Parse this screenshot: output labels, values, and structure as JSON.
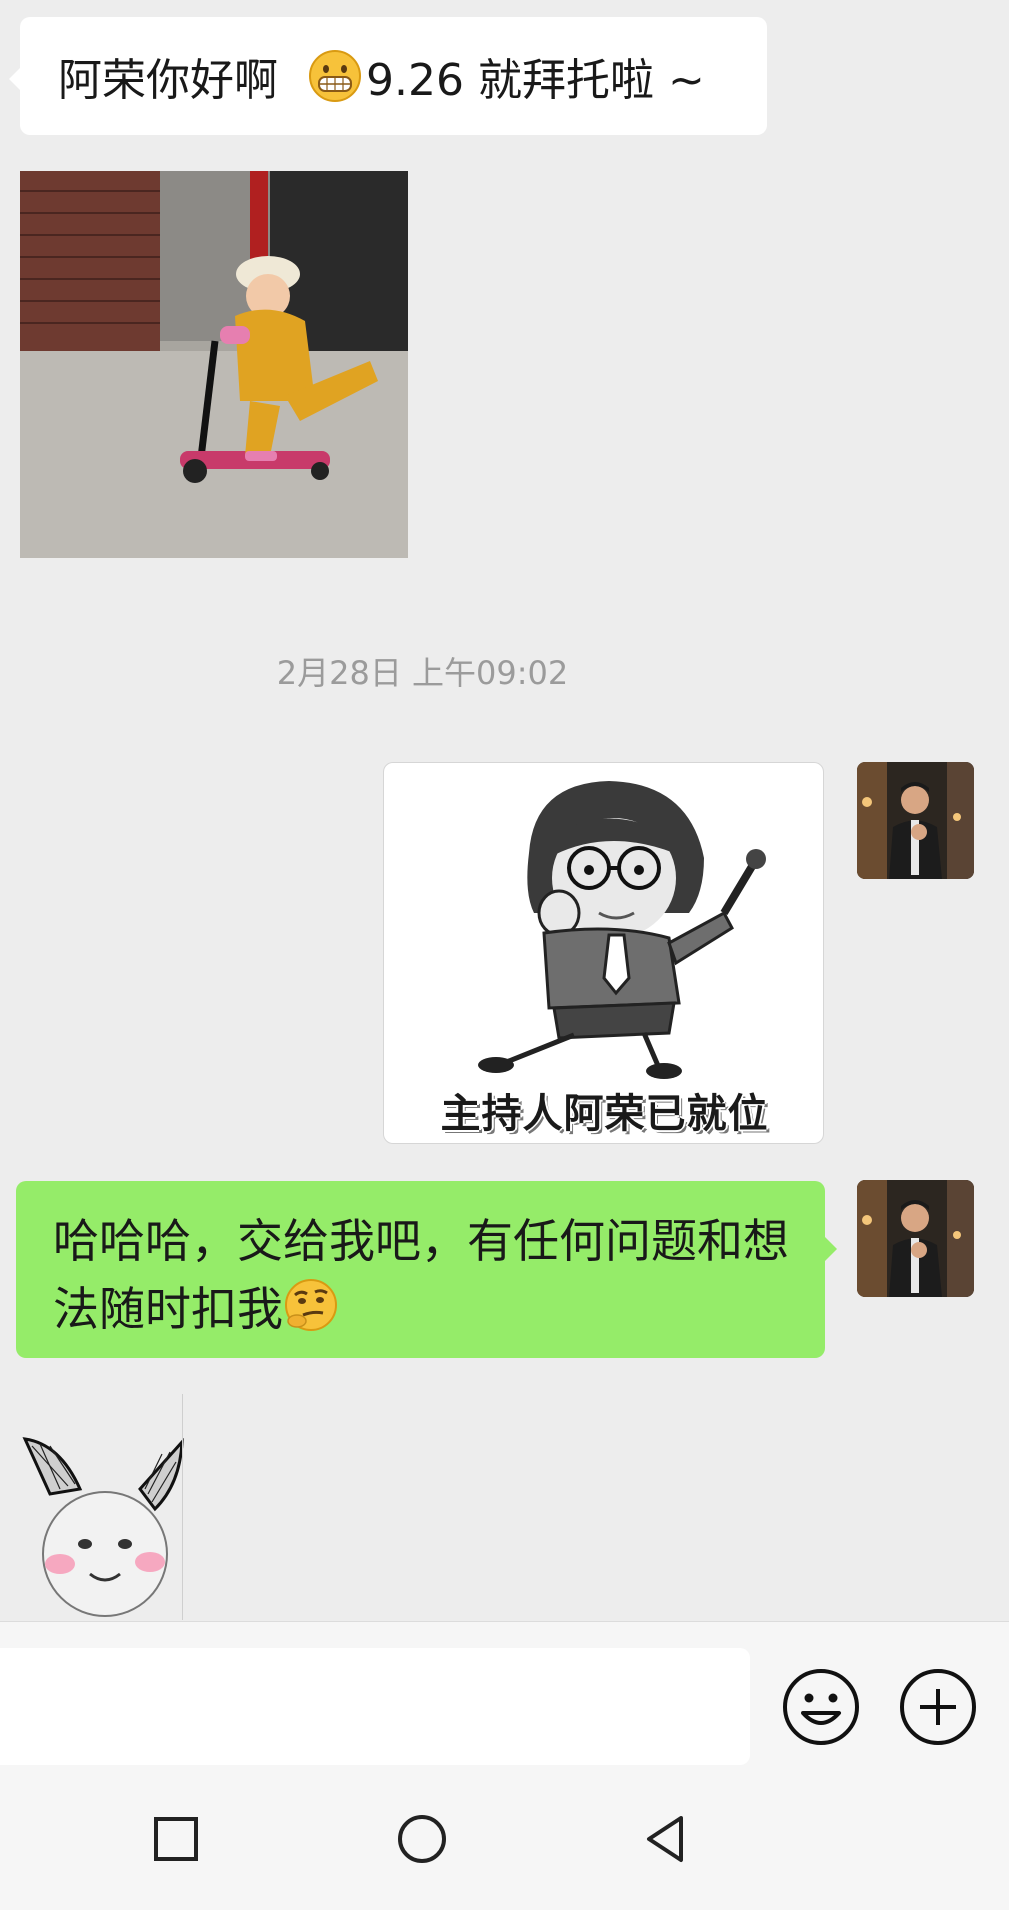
{
  "chat": {
    "incoming_greeting": {
      "text_before": "阿荣你好啊",
      "text_after": "9.26 就拜托啦 ~",
      "emoji": "grinning-face-emoji"
    },
    "incoming_photo": {
      "icon": "child-on-scooter-photo"
    },
    "timestamp": "2月28日 上午09:02",
    "outgoing_sticker": {
      "caption": "主持人阿荣已就位",
      "icon": "cartoon-host-with-microphone-sticker"
    },
    "outgoing_text": {
      "text": "哈哈哈，交给我吧，有任何问题和想法随时扣我",
      "emoji": "thinking-smirk-emoji"
    },
    "incoming_sticker": {
      "icon": "bunny-ears-meme-sticker"
    }
  },
  "input_bar": {
    "value": "",
    "emoji_button_icon": "smiley-icon",
    "more_button_icon": "plus-circle-icon"
  },
  "nav_bar": {
    "recents_icon": "square-icon",
    "home_icon": "circle-icon",
    "back_icon": "triangle-back-icon"
  },
  "colors": {
    "background": "#ededed",
    "incoming_bubble": "#ffffff",
    "outgoing_bubble": "#95ec69",
    "timestamp_text": "#9b9b9b"
  }
}
